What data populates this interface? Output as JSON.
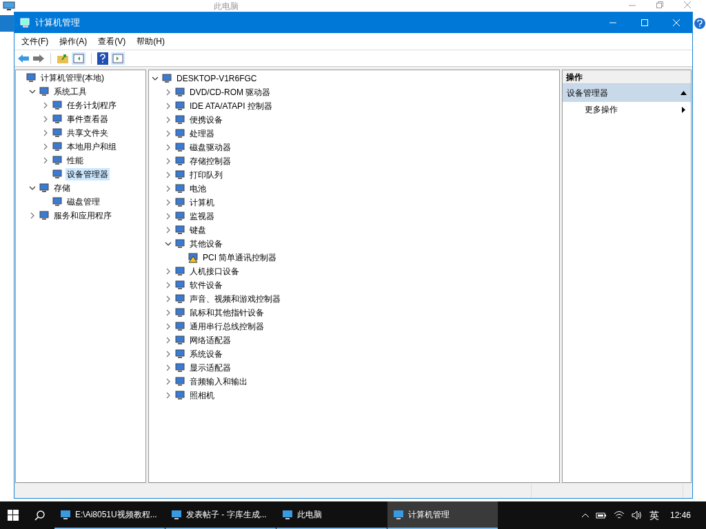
{
  "background_window": {
    "title": "此电脑"
  },
  "window": {
    "title": "计算机管理"
  },
  "menu": [
    "文件(F)",
    "操作(A)",
    "查看(V)",
    "帮助(H)"
  ],
  "console_tree": [
    {
      "label": "计算机管理(本地)",
      "selected": false,
      "children": [
        {
          "label": "系统工具",
          "expanded": true,
          "selected": false,
          "children": [
            {
              "label": "任务计划程序",
              "expanded": false,
              "selected": false
            },
            {
              "label": "事件查看器",
              "expanded": false,
              "selected": false
            },
            {
              "label": "共享文件夹",
              "expanded": false,
              "selected": false
            },
            {
              "label": "本地用户和组",
              "expanded": false,
              "selected": false
            },
            {
              "label": "性能",
              "expanded": false,
              "selected": false
            },
            {
              "label": "设备管理器",
              "selected": true
            }
          ]
        },
        {
          "label": "存储",
          "expanded": true,
          "selected": false,
          "children": [
            {
              "label": "磁盘管理",
              "selected": false
            }
          ]
        },
        {
          "label": "服务和应用程序",
          "expanded": false,
          "selected": false
        }
      ]
    }
  ],
  "device_tree": [
    {
      "label": "DESKTOP-V1R6FGC",
      "expanded": true,
      "children": [
        {
          "label": "DVD/CD-ROM 驱动器",
          "expanded": false
        },
        {
          "label": "IDE ATA/ATAPI 控制器",
          "expanded": false
        },
        {
          "label": "便携设备",
          "expanded": false
        },
        {
          "label": "处理器",
          "expanded": false
        },
        {
          "label": "磁盘驱动器",
          "expanded": false
        },
        {
          "label": "存储控制器",
          "expanded": false
        },
        {
          "label": "打印队列",
          "expanded": false
        },
        {
          "label": "电池",
          "expanded": false
        },
        {
          "label": "计算机",
          "expanded": false
        },
        {
          "label": "监视器",
          "expanded": false
        },
        {
          "label": "键盘",
          "expanded": false
        },
        {
          "label": "其他设备",
          "expanded": true,
          "children": [
            {
              "label": "PCI 简单通讯控制器",
              "warning": true
            }
          ]
        },
        {
          "label": "人机接口设备",
          "expanded": false
        },
        {
          "label": "软件设备",
          "expanded": false
        },
        {
          "label": "声音、视频和游戏控制器",
          "expanded": false
        },
        {
          "label": "鼠标和其他指针设备",
          "expanded": false
        },
        {
          "label": "通用串行总线控制器",
          "expanded": false
        },
        {
          "label": "网络适配器",
          "expanded": false
        },
        {
          "label": "系统设备",
          "expanded": false
        },
        {
          "label": "显示适配器",
          "expanded": false
        },
        {
          "label": "音频输入和输出",
          "expanded": false
        },
        {
          "label": "照相机",
          "expanded": false
        }
      ]
    }
  ],
  "actions_pane": {
    "header": "操作",
    "section": {
      "label": "设备管理器",
      "expanded": true
    },
    "items": [
      "更多操作"
    ]
  },
  "taskbar": {
    "items": [
      {
        "label": "E:\\Ai8051U视频教程...",
        "selected": false
      },
      {
        "label": "发表帖子 - 字库生成...",
        "selected": false
      },
      {
        "label": "此电脑",
        "selected": false
      },
      {
        "label": "计算机管理",
        "selected": true
      }
    ],
    "ime": "英",
    "time": "12:46"
  }
}
